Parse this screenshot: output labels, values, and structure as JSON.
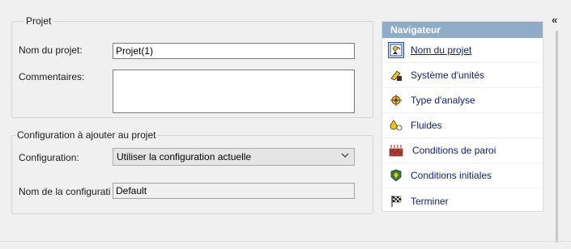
{
  "project_group": {
    "title": "Projet",
    "name_label": "Nom du projet:",
    "name_value": "Projet(1)",
    "comments_label": "Commentaires:",
    "comments_value": ""
  },
  "config_group": {
    "title": "Configuration à ajouter au projet",
    "config_label": "Configuration:",
    "config_selected": "Utiliser la configuration actuelle",
    "config_name_label": "Nom de la configurati",
    "config_name_value": "Default"
  },
  "navigator": {
    "title": "Navigateur",
    "items": [
      {
        "label": "Nom du projet",
        "icon": "project-name-icon"
      },
      {
        "label": "Système d'unités",
        "icon": "units-system-icon"
      },
      {
        "label": "Type d'analyse",
        "icon": "analysis-type-icon"
      },
      {
        "label": "Fluides",
        "icon": "fluids-icon"
      },
      {
        "label": "Conditions de paroi",
        "icon": "wall-conditions-icon"
      },
      {
        "label": "Conditions initiales",
        "icon": "initial-conditions-icon"
      },
      {
        "label": "Terminer",
        "icon": "finish-flag-icon"
      }
    ]
  },
  "collapse_glyph": "«",
  "colors": {
    "navigator_header": "#8eabc8",
    "link_text": "#12236e"
  }
}
